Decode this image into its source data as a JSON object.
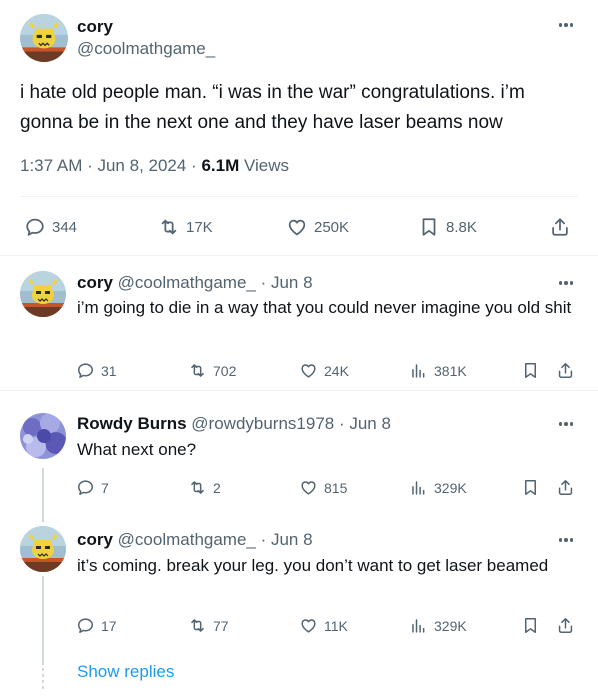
{
  "main_tweet": {
    "display_name": "cory",
    "handle": "@coolmathgame_",
    "text": "i hate old people man. “i was in the war” congratulations. i’m gonna be in the next one and they have laser beams now",
    "time": "1:37 AM · Jun 8, 2024 · ",
    "views_count": "6.1M",
    "views_label": " Views",
    "replies": "344",
    "reposts": "17K",
    "likes": "250K",
    "bookmarks": "8.8K"
  },
  "replies": [
    {
      "display_name": "cory",
      "handle_date": "@coolmathgame_ · Jun 8",
      "text": "i’m going to die in a way that you could never imagine you old shit",
      "replies": "31",
      "reposts": "702",
      "likes": "24K",
      "views": "381K"
    },
    {
      "display_name": "Rowdy Burns",
      "handle_date": "@rowdyburns1978 · Jun 8",
      "text": "What next one?",
      "replies": "7",
      "reposts": "2",
      "likes": "815",
      "views": "329K"
    },
    {
      "display_name": "cory",
      "handle_date": "@coolmathgame_ · Jun 8",
      "text": "it’s coming. break your leg. you don’t want to get laser beamed",
      "replies": "17",
      "reposts": "77",
      "likes": "11K",
      "views": "329K"
    }
  ],
  "show_replies": "Show replies",
  "colors": {
    "accent": "#1d9bf0",
    "secondary_text": "#536471",
    "divider": "#eff3f4"
  }
}
